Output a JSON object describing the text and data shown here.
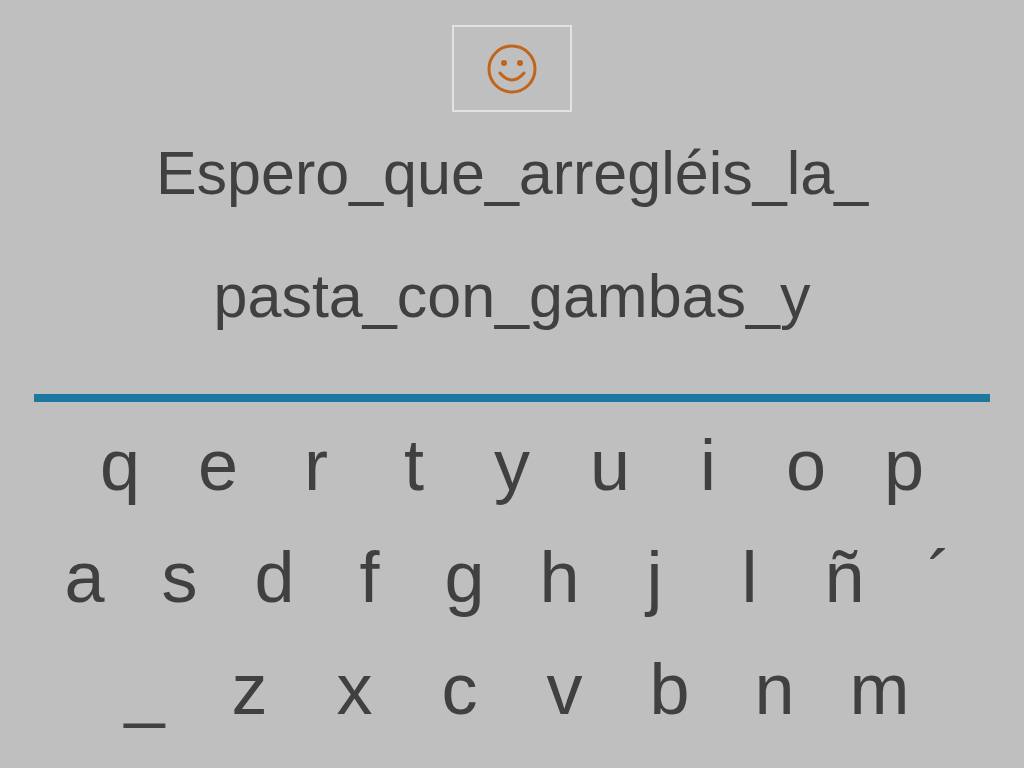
{
  "sentence_lines": [
    "Espero_que_arregléis_la_",
    "pasta_con_gambas_y"
  ],
  "keyboard_rows": [
    [
      "q",
      "e",
      "r",
      "t",
      "y",
      "u",
      "i",
      "o",
      "p"
    ],
    [
      "a",
      "s",
      "d",
      "f",
      "g",
      "h",
      "j",
      "l",
      "ñ",
      "´"
    ],
    [
      "_",
      "z",
      "x",
      "c",
      "v",
      "b",
      "n",
      "m"
    ]
  ]
}
